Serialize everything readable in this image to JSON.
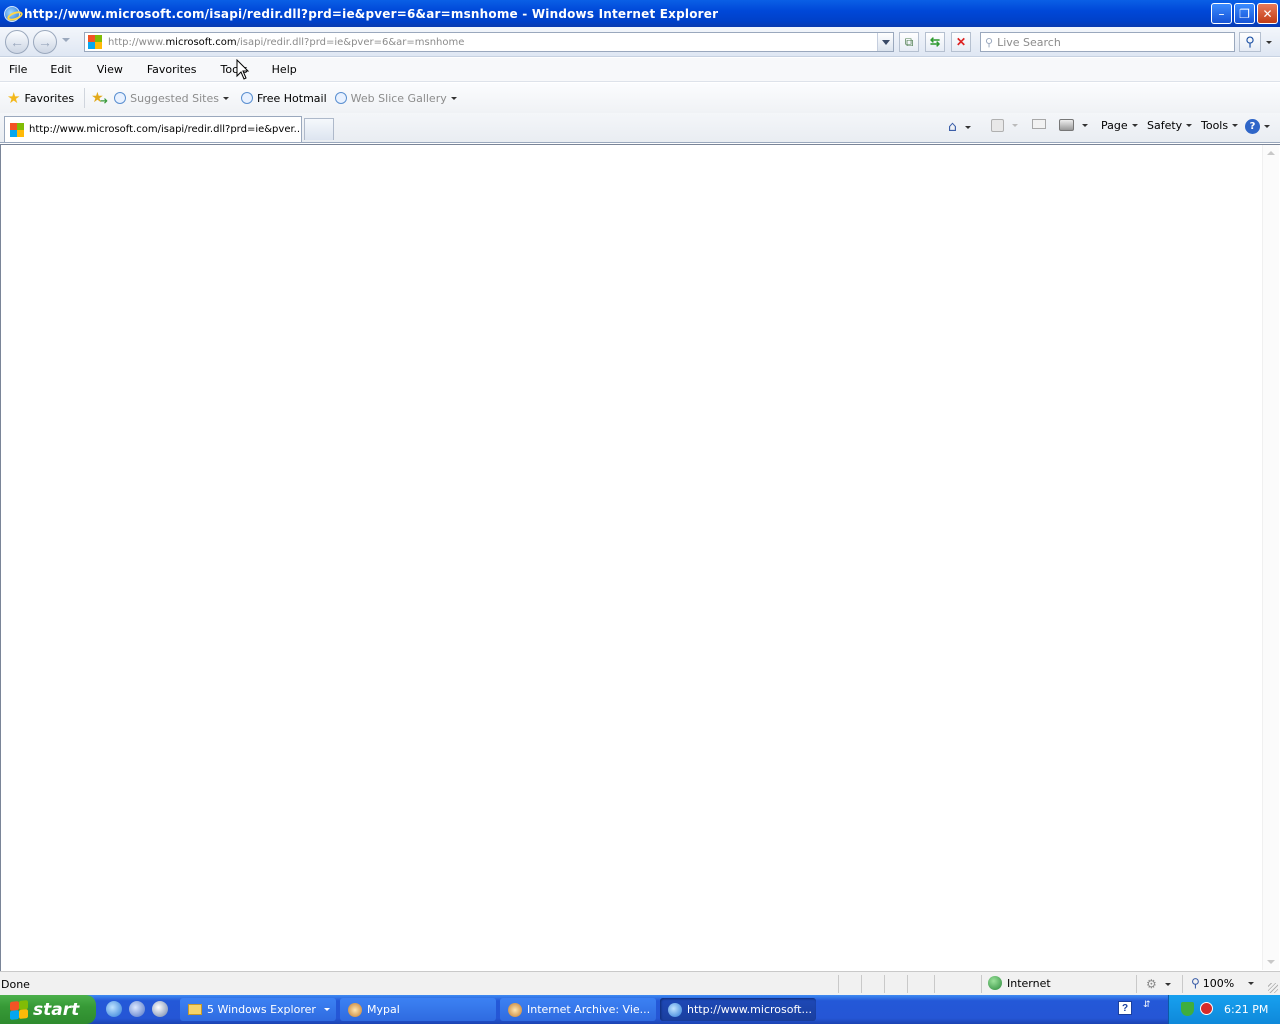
{
  "window": {
    "title": "http://www.microsoft.com/isapi/redir.dll?prd=ie&pver=6&ar=msnhome - Windows Internet Explorer",
    "minimize_glyph": "–",
    "restore_glyph": "❐",
    "close_glyph": "✕"
  },
  "navigation": {
    "back_icon": "back-arrow-icon",
    "forward_icon": "forward-arrow-icon",
    "address_prefix": "http://www.",
    "address_domain": "microsoft.com",
    "address_suffix": "/isapi/redir.dll?prd=ie&pver=6&ar=msnhome",
    "search_placeholder": "Live Search"
  },
  "menubar": {
    "items": [
      "File",
      "Edit",
      "View",
      "Favorites",
      "Tools",
      "Help"
    ]
  },
  "favorites_bar": {
    "favorites_label": "Favorites",
    "suggested_sites": "Suggested Sites",
    "free_hotmail": "Free Hotmail",
    "web_slice_gallery": "Web Slice Gallery"
  },
  "tabs": {
    "active_tab_label": "http://www.microsoft.com/isapi/redir.dll?prd=ie&pver..."
  },
  "command_bar": {
    "page": "Page",
    "safety": "Safety",
    "tools": "Tools",
    "help_glyph": "?"
  },
  "status_bar": {
    "status_text": "Done",
    "zone": "Internet",
    "zoom": "100%"
  },
  "taskbar": {
    "start_label": "start",
    "tasks": [
      {
        "label": "5 Windows Explorer",
        "active": false
      },
      {
        "label": "Mypal",
        "active": false
      },
      {
        "label": "Internet Archive: Vie...",
        "active": false
      },
      {
        "label": "http://www.microsoft...",
        "active": true
      }
    ],
    "clock": "6:21 PM"
  },
  "colors": {
    "titlebar": "#0048d8",
    "taskbar": "#2458d8",
    "start_button": "#379a37",
    "tray": "#0f89da"
  }
}
